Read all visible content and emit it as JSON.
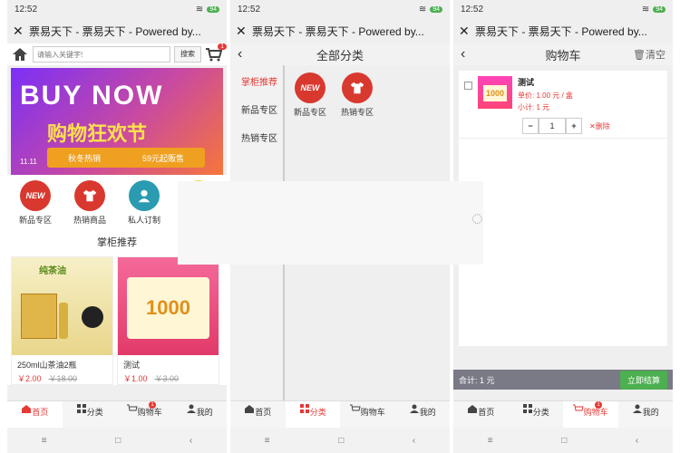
{
  "status": {
    "time": "12:52",
    "battery": "94"
  },
  "app_title": "票易天下 - 票易天下 - Powered by...",
  "home": {
    "search_placeholder": "请输入关键字!",
    "search_button": "搜索",
    "cart_badge": "1",
    "banner": {
      "headline": "BUY NOW",
      "festival": "购物狂欢节",
      "date": "11.11",
      "strip_left": "秋冬热销",
      "strip_right": "59元起贩售"
    },
    "categories": [
      {
        "label": "新品专区",
        "icon": "new-badge-icon",
        "color": "#d9382f"
      },
      {
        "label": "热销商品",
        "icon": "shirt-icon",
        "color": "#d9382f"
      },
      {
        "label": "私人订制",
        "icon": "person-icon",
        "color": "#2a9bb0"
      }
    ],
    "section_title": "掌柜推荐",
    "products": [
      {
        "name": "250ml山茶油2瓶",
        "price": "￥2.00",
        "old_price": "￥18.00",
        "img_text": "纯茶油"
      },
      {
        "name": "测试",
        "price": "￥1.00",
        "old_price": "￥3.00",
        "img_text": "1000"
      }
    ]
  },
  "category_page": {
    "title": "全部分类",
    "menu": [
      "掌柜推荐",
      "新品专区",
      "热销专区"
    ],
    "items": [
      {
        "label": "新品专区",
        "icon": "new-badge-icon"
      },
      {
        "label": "热销专区",
        "icon": "shirt-icon"
      }
    ]
  },
  "cart_page": {
    "title": "购物车",
    "clear": "清空",
    "item": {
      "name": "测试",
      "unit_price": "单价: 1.00 元 / 盒",
      "subtotal": "小计: 1 元",
      "qty": "1",
      "img_text": "1000"
    },
    "delete": "删除",
    "total": "合计: 1 元",
    "checkout": "立即结算"
  },
  "tabs": [
    "首页",
    "分类",
    "购物车",
    "我的"
  ],
  "tab_badge": "1",
  "colors": {
    "accent": "#e53935",
    "pay": "#4caf50"
  }
}
